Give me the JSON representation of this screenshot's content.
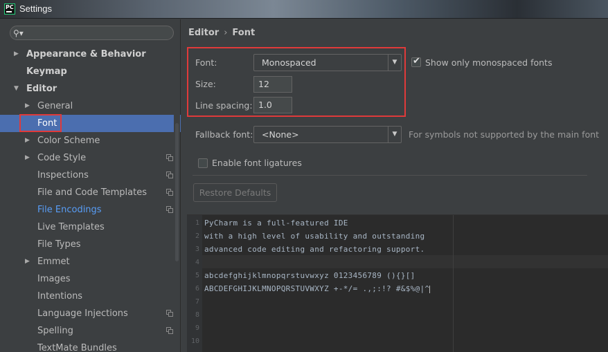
{
  "window": {
    "title": "Settings",
    "app_icon_text": "PC"
  },
  "search": {
    "placeholder": "",
    "value": ""
  },
  "sidebar": {
    "items": [
      {
        "label": "Appearance & Behavior",
        "arrow": "▶",
        "bold": true
      },
      {
        "label": "Keymap",
        "arrow": "",
        "bold": true
      },
      {
        "label": "Editor",
        "arrow": "▼",
        "bold": true
      },
      {
        "label": "General",
        "arrow": "▶"
      },
      {
        "label": "Font",
        "arrow": "",
        "selected": true
      },
      {
        "label": "Color Scheme",
        "arrow": "▶"
      },
      {
        "label": "Code Style",
        "arrow": "▶",
        "copy_icon": true
      },
      {
        "label": "Inspections",
        "arrow": "",
        "copy_icon": true
      },
      {
        "label": "File and Code Templates",
        "arrow": "",
        "copy_icon": true
      },
      {
        "label": "File Encodings",
        "arrow": "",
        "copy_icon": true,
        "link": true
      },
      {
        "label": "Live Templates",
        "arrow": ""
      },
      {
        "label": "File Types",
        "arrow": ""
      },
      {
        "label": "Emmet",
        "arrow": "▶"
      },
      {
        "label": "Images",
        "arrow": ""
      },
      {
        "label": "Intentions",
        "arrow": ""
      },
      {
        "label": "Language Injections",
        "arrow": "",
        "copy_icon": true
      },
      {
        "label": "Spelling",
        "arrow": "",
        "copy_icon": true
      },
      {
        "label": "TextMate Bundles",
        "arrow": ""
      }
    ]
  },
  "breadcrumb": {
    "parent": "Editor",
    "separator": "›",
    "current": "Font"
  },
  "font_settings": {
    "font_label": "Font:",
    "font_value": "Monospaced",
    "show_only_monospaced_label": "Show only monospaced fonts",
    "show_only_monospaced_checked": true,
    "size_label": "Size:",
    "size_value": "12",
    "line_spacing_label": "Line spacing:",
    "line_spacing_value": "1.0",
    "fallback_label": "Fallback font:",
    "fallback_value": "<None>",
    "fallback_note": "For symbols not supported by the main font",
    "ligatures_label": "Enable font ligatures",
    "ligatures_checked": false,
    "restore_button": "Restore Defaults"
  },
  "preview": {
    "line_numbers": [
      "1",
      "2",
      "3",
      "4",
      "5",
      "6",
      "7",
      "8",
      "9",
      "10"
    ],
    "lines": [
      "PyCharm is a full-featured IDE",
      "with a high level of usability and outstanding",
      "advanced code editing and refactoring support.",
      "",
      "abcdefghijklmnopqrstuvwxyz 0123456789 (){}[]",
      "ABCDEFGHIJKLMNOPQRSTUVWXYZ +-*/= .,;:!? #&$%@|^"
    ]
  },
  "colors": {
    "accent": "#4b6eaf",
    "highlight_border": "#e03a3a",
    "link": "#589df6"
  }
}
